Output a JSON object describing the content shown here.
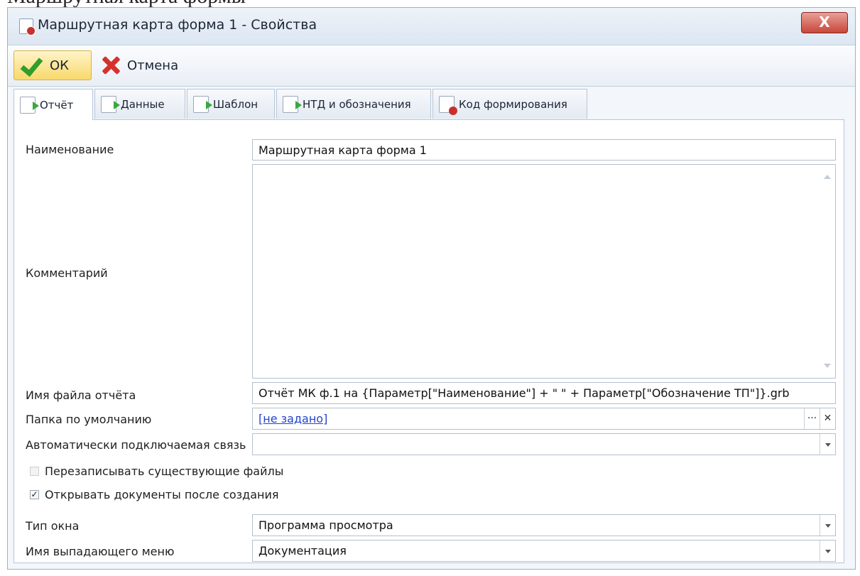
{
  "window": {
    "title": "Маршрутная карта форма 1 - Свойства",
    "close_label": "X",
    "heading_fragment": "Маршрутная карта формы"
  },
  "toolbar": {
    "ok_label": "ОК",
    "cancel_label": "Отмена"
  },
  "tabs": [
    {
      "label": "Отчёт",
      "active": true
    },
    {
      "label": "Данные",
      "active": false
    },
    {
      "label": "Шаблон",
      "active": false
    },
    {
      "label": "НТД и обозначения",
      "active": false
    },
    {
      "label": "Код формирования",
      "active": false
    }
  ],
  "form": {
    "name_label": "Наименование",
    "name_value": "Маршрутная карта форма 1",
    "comment_label": "Комментарий",
    "comment_value": "",
    "filename_label": "Имя файла отчёта",
    "filename_value": "Отчёт МК ф.1 на {Параметр[\"Наименование\"] + \" \" + Параметр[\"Обозначение ТП\"]}.grb",
    "folder_label": "Папка по умолчанию",
    "folder_value": "[не задано]",
    "folder_browse": "···",
    "folder_clear": "✕",
    "autolink_label": "Автоматически подключаемая связь",
    "autolink_value": "",
    "overwrite_label": "Перезаписывать существующие файлы",
    "overwrite_checked": false,
    "open_after_label": "Открывать документы после создания",
    "open_after_checked": true,
    "window_type_label": "Тип окна",
    "window_type_value": "Программа просмотра",
    "menu_name_label": "Имя выпадающего меню",
    "menu_name_value": "Документация"
  }
}
